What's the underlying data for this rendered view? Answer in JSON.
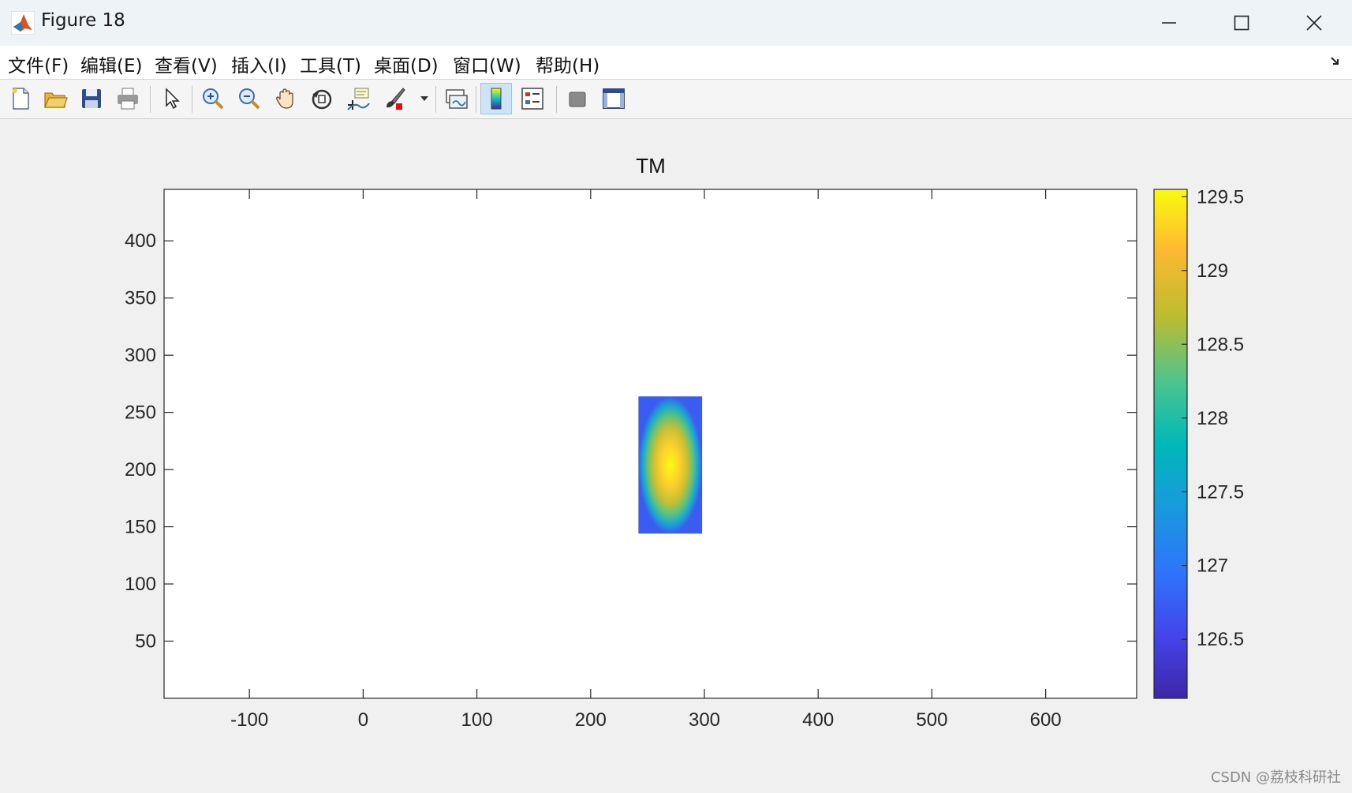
{
  "window": {
    "title": "Figure 18",
    "app_icon": "matlab-logo-icon",
    "controls": [
      "minimize-icon",
      "maximize-icon",
      "close-icon"
    ]
  },
  "menu": {
    "items": [
      {
        "label": "文件(F)"
      },
      {
        "label": "编辑(E)"
      },
      {
        "label": "查看(V)"
      },
      {
        "label": "插入(I)"
      },
      {
        "label": "工具(T)"
      },
      {
        "label": "桌面(D)"
      },
      {
        "label": "窗口(W)"
      },
      {
        "label": "帮助(H)"
      }
    ]
  },
  "toolbar": {
    "buttons": [
      "new-figure-icon",
      "open-file-icon",
      "save-icon",
      "print-icon",
      "select-arrow-icon",
      "zoom-in-icon",
      "zoom-out-icon",
      "pan-hand-icon",
      "rotate-3d-icon",
      "data-cursor-icon",
      "brush-icon",
      "link-plot-icon",
      "colorbar-icon",
      "legend-icon",
      "hide-plot-tools-icon",
      "show-plot-tools-icon"
    ],
    "active": "colorbar-icon"
  },
  "chart_data": {
    "type": "heatmap",
    "title": "TM",
    "xlabel": "",
    "ylabel": "",
    "xlim": [
      -175,
      680
    ],
    "ylim": [
      0,
      445
    ],
    "xticks": [
      -100,
      0,
      100,
      200,
      300,
      400,
      500,
      600
    ],
    "yticks": [
      50,
      100,
      150,
      200,
      250,
      300,
      350,
      400
    ],
    "xtick_labels": [
      "-100",
      "0",
      "100",
      "200",
      "300",
      "400",
      "500",
      "600"
    ],
    "ytick_labels": [
      "50",
      "100",
      "150",
      "200",
      "250",
      "300",
      "350",
      "400"
    ],
    "patch": {
      "x_range": [
        242,
        298
      ],
      "y_range": [
        144,
        264
      ],
      "center": [
        268,
        204
      ],
      "center_value": 129.5,
      "corner_value": 126.2
    },
    "colorbar": {
      "colormap": "parula",
      "clim": [
        126.1,
        129.55
      ],
      "ticks": [
        126.5,
        127,
        127.5,
        128,
        128.5,
        129,
        129.5
      ],
      "tick_labels": [
        "126.5",
        "127",
        "127.5",
        "128",
        "128.5",
        "129",
        "129.5"
      ]
    },
    "grid": false,
    "legend": "none"
  },
  "watermark": "CSDN @荔枝科研社"
}
